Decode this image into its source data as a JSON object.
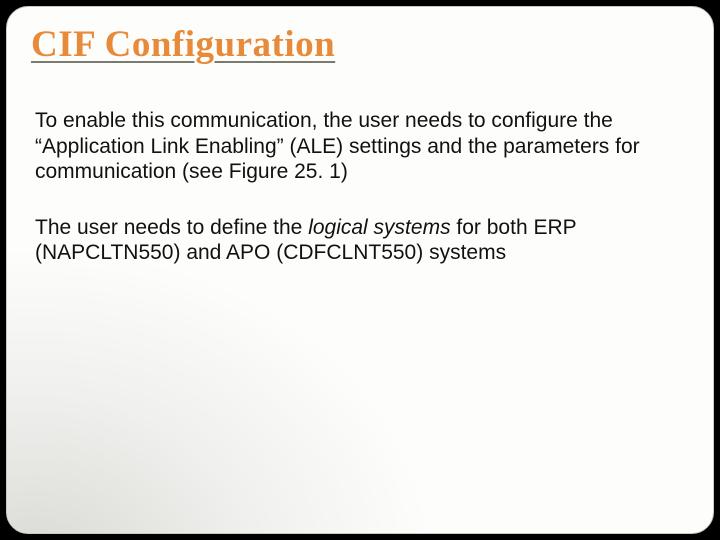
{
  "title": "CIF Configuration",
  "paragraphs": {
    "p1": "To enable this communication, the user needs to configure the “Application Link Enabling” (ALE) settings and the parameters for communication (see Figure 25. 1)",
    "p2_a": "The user needs to define the ",
    "p2_italic": "logical systems",
    "p2_b": " for both ERP (NAPCLTN550) and APO (CDFCLNT550) systems"
  }
}
